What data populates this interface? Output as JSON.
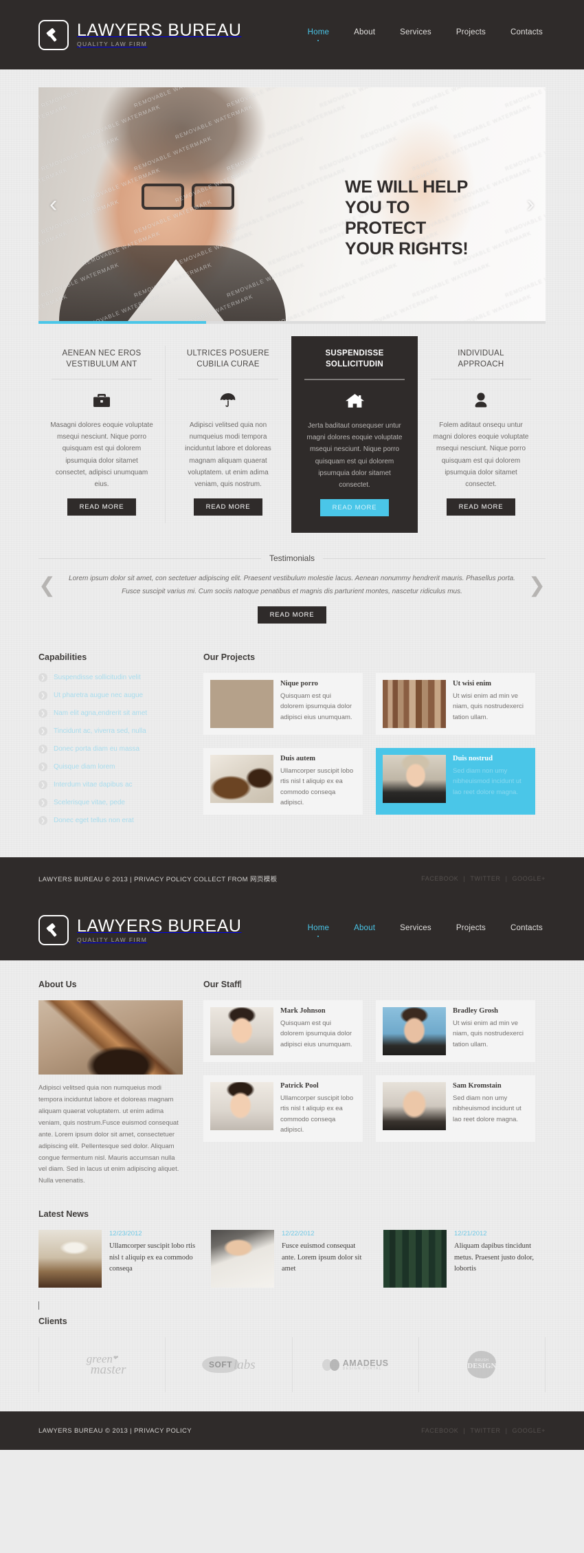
{
  "brand": {
    "name": "LAWYERS BUREAU",
    "tagline": "QUALITY LAW FIRM",
    "logo_icon": "gavel-icon",
    "accent_color": "#4ac6e8",
    "dark_color": "#2f2b2a"
  },
  "nav": {
    "items": [
      {
        "label": "Home",
        "active": true
      },
      {
        "label": "About",
        "active": false
      },
      {
        "label": "Services",
        "active": false
      },
      {
        "label": "Projects",
        "active": false
      },
      {
        "label": "Contacts",
        "active": false
      }
    ]
  },
  "nav2": {
    "items": [
      {
        "label": "Home",
        "active": true
      },
      {
        "label": "About",
        "active": true
      },
      {
        "label": "Services",
        "active": false
      },
      {
        "label": "Projects",
        "active": false
      },
      {
        "label": "Contacts",
        "active": false
      }
    ]
  },
  "slider": {
    "caption_line1": "WE WILL HELP",
    "caption_line2": "YOU TO",
    "caption_line3": "PROTECT",
    "caption_line4": "YOUR RIGHTS!",
    "prev_icon": "chevron-left-icon",
    "next_icon": "chevron-right-icon",
    "watermark_text": "REMOVABLE WATERMARK",
    "progress_percent": "33"
  },
  "features": [
    {
      "title_line1": "AENEAN NEC EROS",
      "title_line2": "VESTIBULUM ANT",
      "icon": "briefcase-icon",
      "text": "Masagni dolores eoquie voluptate msequi nesciunt. Nique porro quisquam est qui dolorem ipsumquia dolor sitamet consectet, adipisci unumquam eius.",
      "button": "READ MORE",
      "dark": false
    },
    {
      "title_line1": "ULTRICES POSUERE",
      "title_line2": "CUBILIA CURAE",
      "icon": "umbrella-icon",
      "text": "Adipisci velitsed quia non numqueius modi tempora inciduntut labore et doloreas magnam aliquam quaerat voluptatem. ut enim adima veniam, quis nostrum.",
      "button": "READ MORE",
      "dark": false
    },
    {
      "title_line1": "SUSPENDISSE",
      "title_line2": "SOLLICITUDIN",
      "icon": "home-icon",
      "text": "Jerta baditaut onsequser untur magni dolores eoquie voluptate msequi nesciunt. Nique porro quisquam est qui dolorem ipsumquia dolor sitamet consectet.",
      "button": "READ MORE",
      "dark": true
    },
    {
      "title_line1": "INDIVIDUAL",
      "title_line2": "APPROACH",
      "icon": "user-icon",
      "text": "Folem aditaut onsequ untur magni dolores eoquie voluptate msequi nesciunt. Nique porro quisquam est qui dolorem ipsumquia dolor sitamet consectet.",
      "button": "READ MORE",
      "dark": false
    }
  ],
  "testimonials": {
    "heading": "Testimonials",
    "quote_line1": "Lorem ipsum dolor sit amet, con sectetuer adipiscing elit. Praesent vestibulum molestie lacus. Aenean nonummy hendrerit mauris. Phasellus porta.",
    "quote_line2": "Fusce suscipit varius mi. Cum sociis natoque penatibus et magnis dis parturient montes, nascetur ridiculus mus.",
    "button": "READ MORE",
    "prev_icon": "chevron-left-icon",
    "next_icon": "chevron-right-icon"
  },
  "capabilities": {
    "title": "Capabilities",
    "items": [
      "Suspendisse sollicitudin velit",
      "Ut pharetra augue nec augue",
      "Nam elit agna,endrerit sit amet",
      "Tincidunt ac, viverra sed, nulla",
      "Donec porta diam eu massa",
      "Quisque diam lorem",
      "Interdum vitae dapibus ac",
      "Scelerisque vitae, pede",
      "Donec eget tellus non erat"
    ],
    "bullet_icon": "chevron-right-circle-icon"
  },
  "projects": {
    "title": "Our Projects",
    "items": [
      {
        "title": "Nique porro",
        "text": "Quisquam est qui dolorem ipsumquia dolor adipisci eius unumquam.",
        "thumb": "woman-at-desk-photo",
        "highlighted": false
      },
      {
        "title": "Ut wisi enim",
        "text": "Ut wisi enim ad min ve niam, quis nostrudexerci tation ullam.",
        "thumb": "open-book-photo",
        "highlighted": false
      },
      {
        "title": "Duis autem",
        "text": "Ullamcorper suscipit lobo rtis nisl t aliquip ex ea commodo conseqa adipisci.",
        "thumb": "briefcase-photo",
        "highlighted": false
      },
      {
        "title": "Duis nostrud",
        "text": "Sed diam non umy nibheuismod incidunt ut lao reet dolore magna.",
        "thumb": "senior-woman-photo",
        "highlighted": true
      }
    ]
  },
  "footbar": {
    "copyright": "LAWYERS BUREAU © 2013 | PRIVACY POLICY COLLECT FROM 网页模板",
    "socials": [
      "FACEBOOK",
      "TWITTER",
      "GOOGLE+"
    ],
    "separator": "|"
  },
  "about": {
    "title": "About Us",
    "image": "gavel-photo",
    "text": "Adipisci velitsed quia non numqueius modi tempora inciduntut labore et doloreas magnam aliquam quaerat voluptatem. ut enim adima veniam, quis nostrum.Fusce euismod consequat ante. Lorem ipsum dolor sit amet, consectetuer adipiscing elit. Pellentesque sed dolor. Aliquam congue fermentum nisl. Mauris accumsan nulla vel diam. Sed in lacus ut enim adipiscing aliquet. Nulla venenatis."
  },
  "staff": {
    "title": "Our Staff",
    "items": [
      {
        "name": "Mark Johnson",
        "text": "Quisquam est qui dolorem ipsumquia dolor adipisci eius unumquam.",
        "thumb": "mark-johnson-photo"
      },
      {
        "name": "Bradley Grosh",
        "text": "Ut wisi enim ad min ve niam, quis nostrudexerci tation ullam.",
        "thumb": "bradley-grosh-photo"
      },
      {
        "name": "Patrick Pool",
        "text": "Ullamcorper suscipit lobo rtis nisl t aliquip ex ea commodo conseqa adipisci.",
        "thumb": "patrick-pool-photo"
      },
      {
        "name": "Sam Kromstain",
        "text": "Sed diam non umy nibheuismod incidunt ut lao reet dolore magna.",
        "thumb": "sam-kromstain-photo"
      }
    ]
  },
  "news": {
    "title": "Latest News",
    "items": [
      {
        "date": "12/23/2012",
        "text": "Ullamcorper suscipit lobo rtis nisl t aliquip ex ea commodo conseqa",
        "thumb": "glasses-on-book-photo"
      },
      {
        "date": "12/22/2012",
        "text": "Fusce euismod consequat ante. Lorem ipsum dolor sit amet",
        "thumb": "signing-documents-photo"
      },
      {
        "date": "12/21/2012",
        "text": "Aliquam dapibus tincidunt metus. Praesent justo dolor, lobortis",
        "thumb": "law-books-shelf-photo"
      }
    ]
  },
  "clients": {
    "title": "Clients",
    "items": [
      {
        "name": "green master",
        "word1": "green",
        "word2": "master"
      },
      {
        "name": "SOFT labs",
        "word1": "SOFT",
        "word2": "labs"
      },
      {
        "name": "AMADEUS",
        "word1": "AMADEUS",
        "word2": "DESIGN PORTAL"
      },
      {
        "name": "Brush Design",
        "word1": "BRUSH",
        "word2": "DESIGN"
      }
    ]
  },
  "footer": {
    "copyright": "LAWYERS BUREAU © 2013 | PRIVACY POLICY",
    "socials": [
      "FACEBOOK",
      "TWITTER",
      "GOOGLE+"
    ],
    "separator": "|"
  }
}
